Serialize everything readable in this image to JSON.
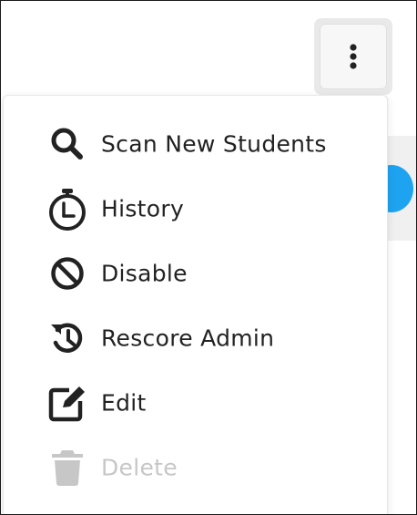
{
  "kebab_button": {
    "icon": "kebab-vertical-icon"
  },
  "menu": {
    "items": [
      {
        "label": "Scan New Students",
        "icon": "search-icon",
        "enabled": true
      },
      {
        "label": "History",
        "icon": "stopwatch-icon",
        "enabled": true
      },
      {
        "label": "Disable",
        "icon": "ban-icon",
        "enabled": true
      },
      {
        "label": "Rescore Admin",
        "icon": "history-restore-icon",
        "enabled": true
      },
      {
        "label": "Edit",
        "icon": "edit-icon",
        "enabled": true
      },
      {
        "label": "Delete",
        "icon": "trash-icon",
        "enabled": false
      }
    ]
  },
  "colors": {
    "icon": "#222222",
    "text": "#222222",
    "disabled": "#c7c7c7",
    "accent": "#1ea3f0"
  }
}
